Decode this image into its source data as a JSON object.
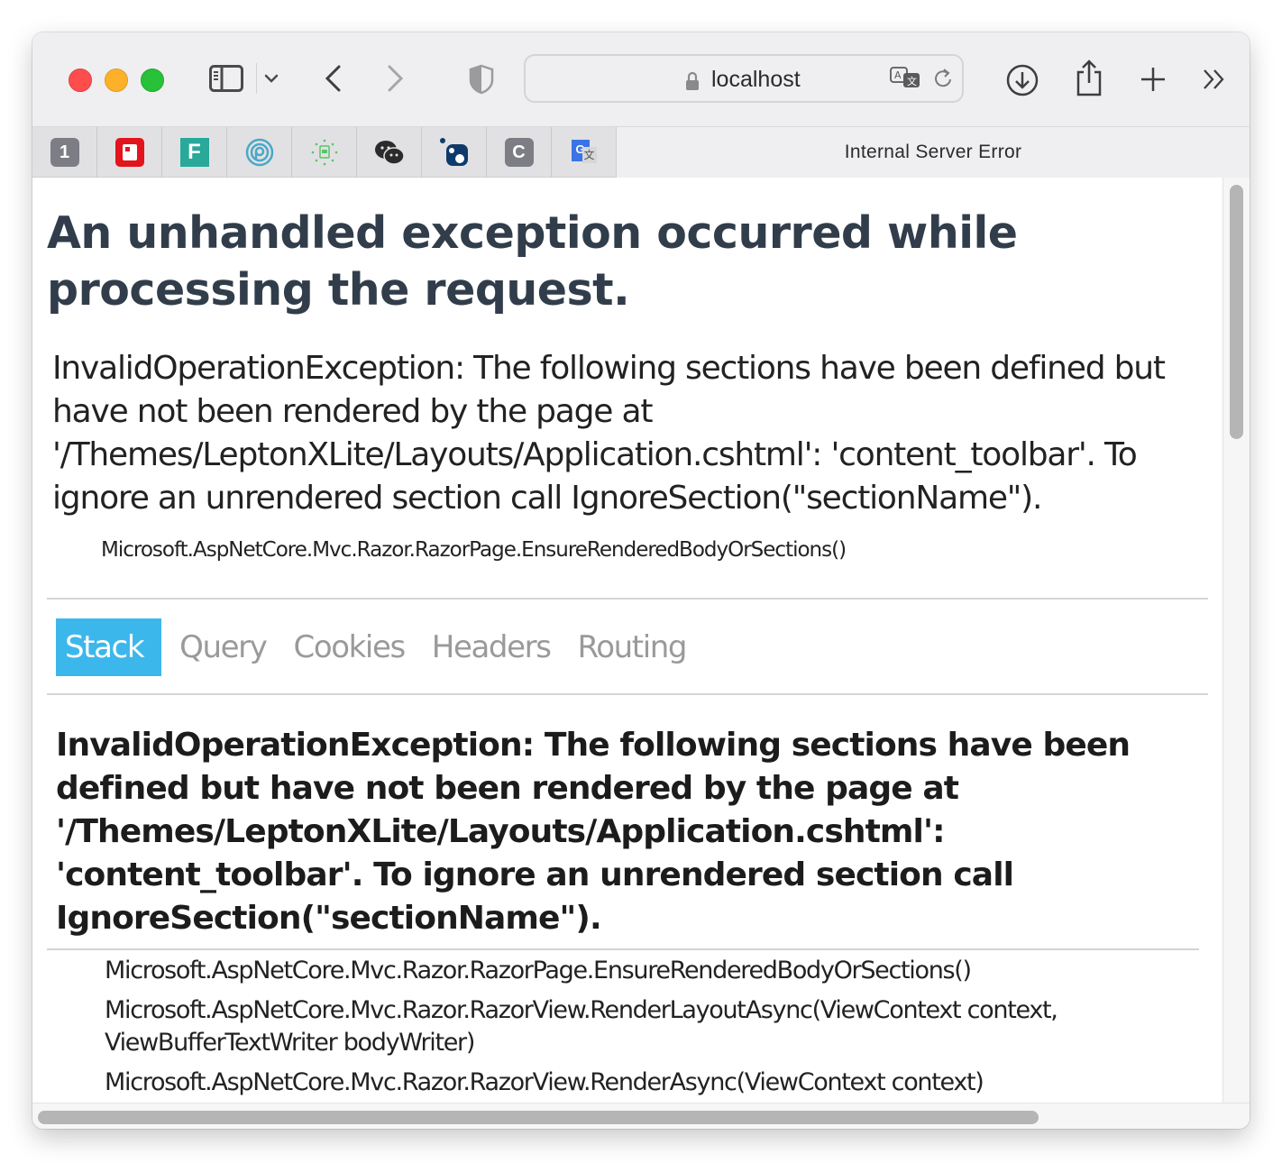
{
  "browser": {
    "address": "localhost",
    "active_tab_title": "Internal Server Error",
    "toolbar_icons": [
      "sidebar-toggle-icon",
      "chevron-down-icon",
      "back-icon",
      "forward-icon",
      "privacy-shield-icon",
      "lock-icon",
      "translate-icon",
      "reload-icon",
      "download-icon",
      "share-icon",
      "new-tab-icon",
      "more-chevrons-icon"
    ],
    "pinned_tabs": [
      {
        "name": "pinned-tab-1password",
        "glyph": "1",
        "bg": "#7d7d85",
        "fg": "#ffffff"
      },
      {
        "name": "pinned-tab-red-app",
        "glyph": "",
        "bg": "#e3141c",
        "fg": "#ffffff"
      },
      {
        "name": "pinned-tab-f-app",
        "glyph": "F",
        "bg": "#28a99a",
        "fg": "#ffffff"
      },
      {
        "name": "pinned-tab-fingerprint-app",
        "glyph": "",
        "bg": "#4aa8c9",
        "fg": "#ffffff"
      },
      {
        "name": "pinned-tab-green-app",
        "glyph": "",
        "bg": "#5ac36a",
        "fg": "#ffffff"
      },
      {
        "name": "pinned-tab-wechat",
        "glyph": "",
        "bg": "#2b2b2b",
        "fg": "#ffffff"
      },
      {
        "name": "pinned-tab-nuget",
        "glyph": "",
        "bg": "#0e3a6b",
        "fg": "#ffffff"
      },
      {
        "name": "pinned-tab-c-app",
        "glyph": "C",
        "bg": "#7d7d85",
        "fg": "#ffffff"
      },
      {
        "name": "pinned-tab-google-translate",
        "glyph": "G",
        "bg": "#3a73e8",
        "fg": "#ffffff"
      }
    ]
  },
  "page": {
    "title": "An unhandled exception occurred while processing the request.",
    "exception_message": "InvalidOperationException: The following sections have been defined but have not been rendered by the page at '/Themes/LeptonXLite/Layouts/Application.cshtml': 'content_toolbar'. To ignore an unrendered section call IgnoreSection(\"sectionName\").",
    "exception_location": "Microsoft.AspNetCore.Mvc.Razor.RazorPage.EnsureRenderedBodyOrSections()",
    "tabs": [
      {
        "label": "Stack",
        "selected": true
      },
      {
        "label": "Query",
        "selected": false
      },
      {
        "label": "Cookies",
        "selected": false
      },
      {
        "label": "Headers",
        "selected": false
      },
      {
        "label": "Routing",
        "selected": false
      }
    ],
    "stack": {
      "title": "InvalidOperationException: The following sections have been defined but have not been rendered by the page at '/Themes/LeptonXLite/Layouts/Application.cshtml': 'content_toolbar'. To ignore an unrendered section call IgnoreSection(\"sectionName\").",
      "frames": [
        "Microsoft.AspNetCore.Mvc.Razor.RazorPage.EnsureRenderedBodyOrSections()",
        "Microsoft.AspNetCore.Mvc.Razor.RazorView.RenderLayoutAsync(ViewContext context, ViewBufferTextWriter bodyWriter)",
        "Microsoft.AspNetCore.Mvc.Razor.RazorView.RenderAsync(ViewContext context)"
      ]
    }
  },
  "colors": {
    "accent": "#3cb7ec",
    "title": "#313d4a",
    "tab_inactive": "#9a9a9a"
  }
}
